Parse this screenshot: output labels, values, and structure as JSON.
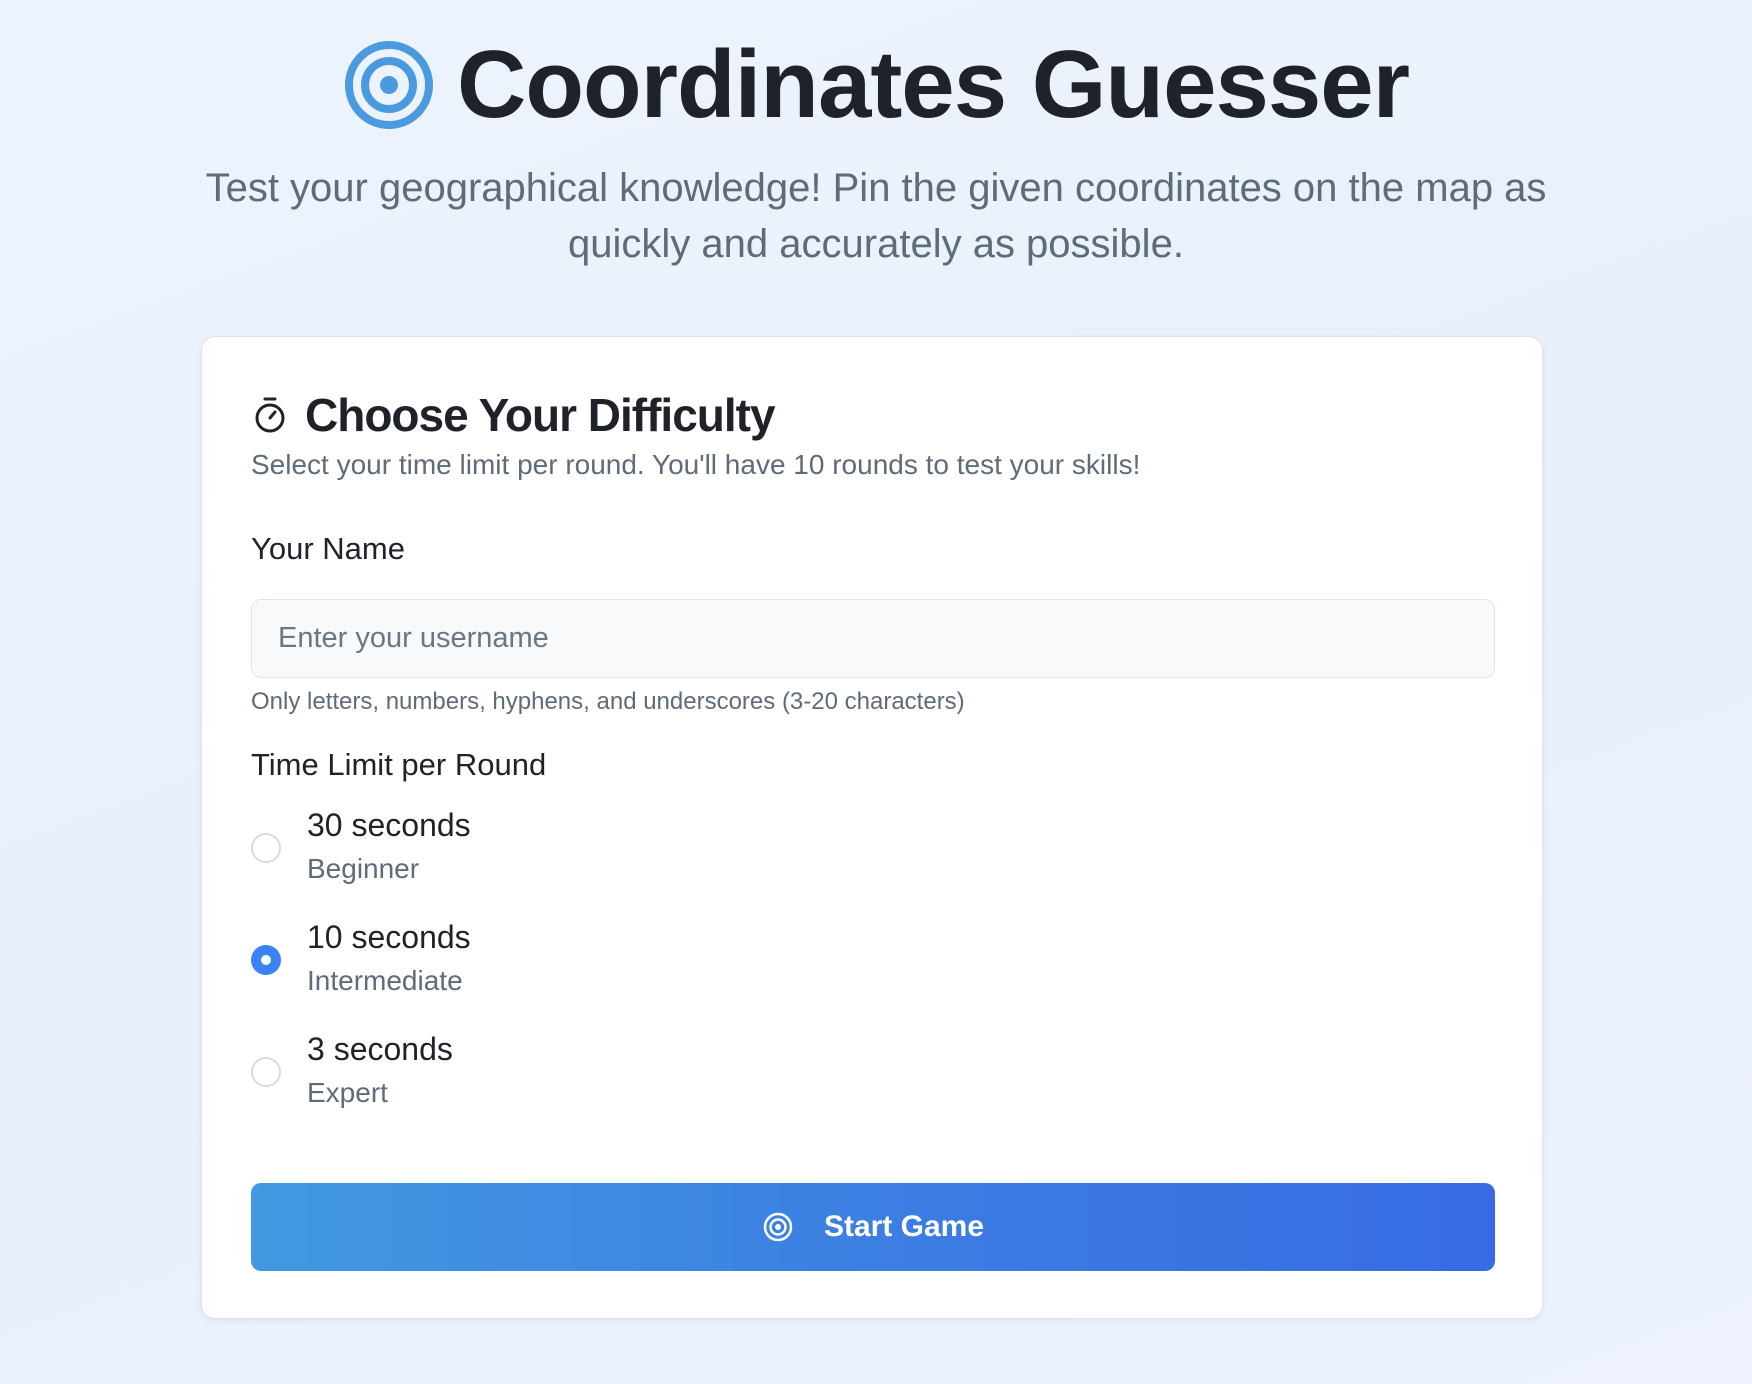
{
  "header": {
    "title": "Coordinates Guesser",
    "subtitle": "Test your geographical knowledge! Pin the given coordinates on the map as quickly and accurately as possible.",
    "icon": "target-icon",
    "accent_color": "#4a9ae0"
  },
  "card": {
    "title": "Choose Your Difficulty",
    "title_icon": "stopwatch-icon",
    "description": "Select your time limit per round. You'll have 10 rounds to test your skills!",
    "name": {
      "label": "Your Name",
      "placeholder": "Enter your username",
      "value": "",
      "helper": "Only letters, numbers, hyphens, and underscores (3-20 characters)"
    },
    "time_limit": {
      "label": "Time Limit per Round",
      "options": [
        {
          "label": "30 seconds",
          "level": "Beginner",
          "selected": false
        },
        {
          "label": "10 seconds",
          "level": "Intermediate",
          "selected": true
        },
        {
          "label": "3 seconds",
          "level": "Expert",
          "selected": false
        }
      ],
      "selected_color": "#3b82f6"
    },
    "start_button": {
      "label": "Start Game",
      "icon": "target-icon",
      "gradient_start": "#4299e1",
      "gradient_end": "#386be3"
    }
  }
}
